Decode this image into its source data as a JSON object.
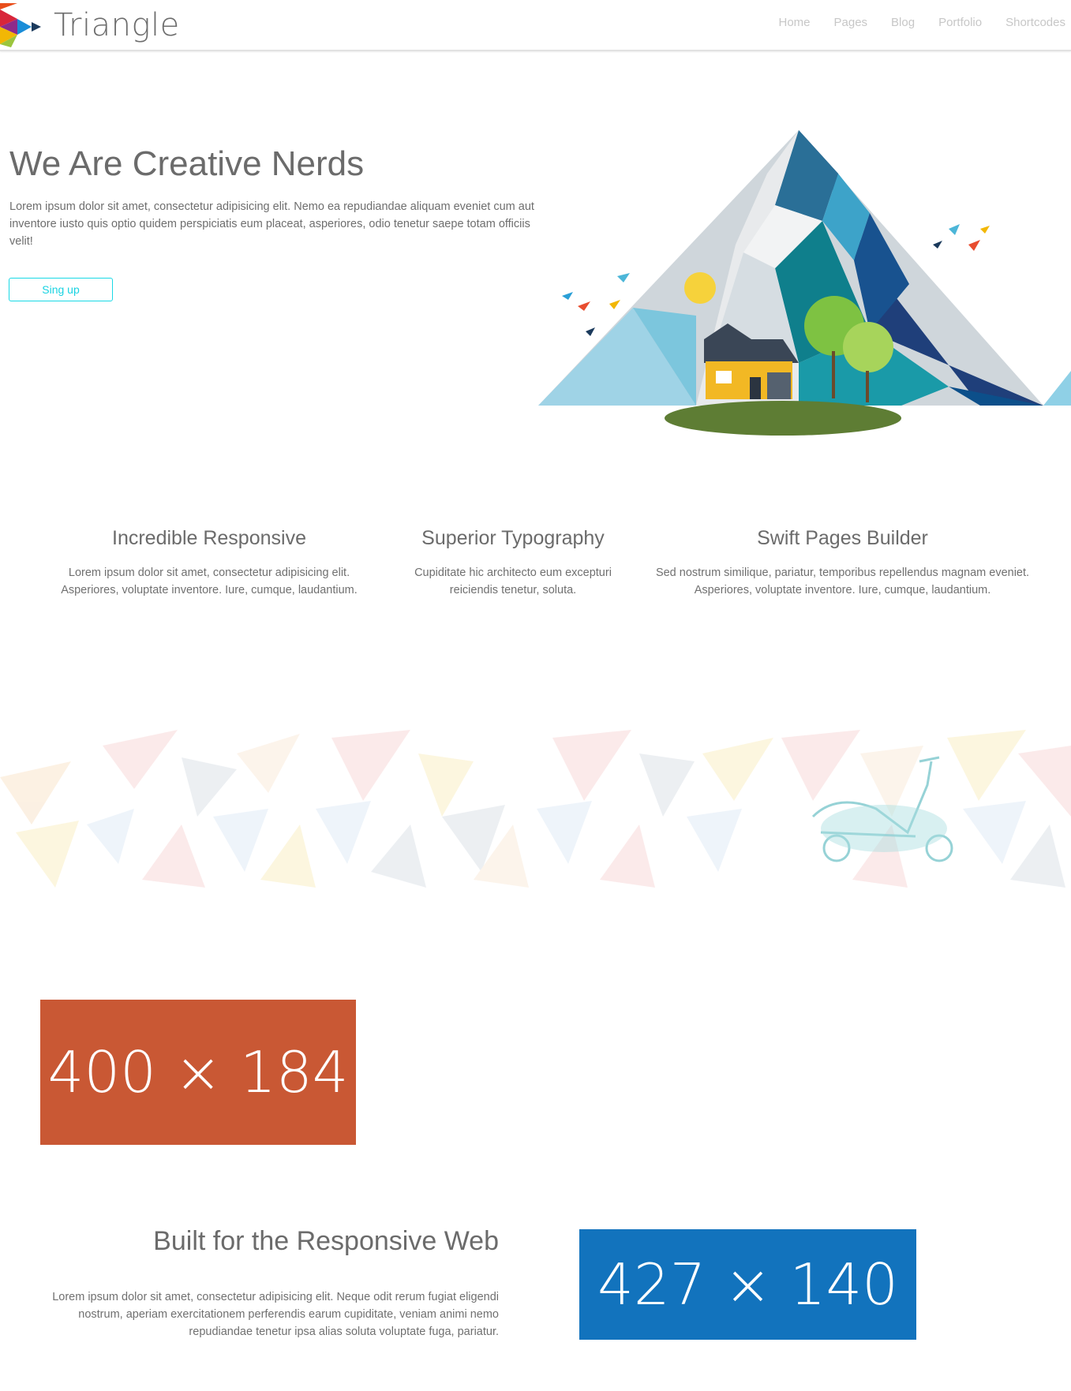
{
  "header": {
    "brand": "Triangle",
    "nav": [
      "Home",
      "Pages",
      "Blog",
      "Portfolio",
      "Shortcodes"
    ]
  },
  "hero": {
    "title": "We Are Creative Nerds",
    "text": "Lorem ipsum dolor sit amet, consectetur adipisicing elit. Nemo ea repudiandae aliquam eveniet cum aut inventore iusto quis optio quidem perspiciatis eum placeat, asperiores, odio tenetur saepe totam officiis velit!",
    "button": "Sing up"
  },
  "features": [
    {
      "title": "Incredible Responsive",
      "text": "Lorem ipsum dolor sit amet, consectetur adipisicing elit. Asperiores, voluptate inventore. Iure, cumque, laudantium."
    },
    {
      "title": "Superior Typography",
      "text": "Cupiditate hic architecto eum excepturi reiciendis tenetur, soluta."
    },
    {
      "title": "Swift Pages Builder",
      "text": "Sed nostrum similique, pariatur, temporibus repellendus magnam eveniet. Asperiores, voluptate inventore. Iure, cumque, laudantium."
    }
  ],
  "placeholders": {
    "orange": "400 × 184",
    "blue": "427 × 140"
  },
  "responsive": {
    "title": "Built for the Responsive Web",
    "text": "Lorem ipsum dolor sit amet, consectetur adipisicing elit. Neque odit rerum fugiat eligendi nostrum, aperiam exercitationem perferendis earum cupiditate, veniam animi nemo repudiandae tenetur ipsa alias soluta voluptate fuga, pariatur."
  },
  "colors": {
    "accent": "#1ad9e6",
    "placeholder_orange": "#c95834",
    "placeholder_blue": "#1273bd"
  }
}
